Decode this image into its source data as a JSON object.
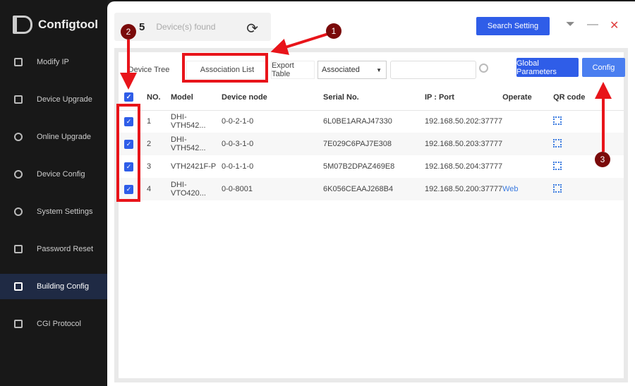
{
  "app": {
    "title": "Configtool"
  },
  "sidebar": {
    "items": [
      {
        "label": "Modify IP",
        "icon": "modify-ip-icon"
      },
      {
        "label": "Device Upgrade",
        "icon": "upgrade-icon"
      },
      {
        "label": "Online Upgrade",
        "icon": "cloud-upgrade-icon"
      },
      {
        "label": "Device Config",
        "icon": "config-icon"
      },
      {
        "label": "System Settings",
        "icon": "settings-icon"
      },
      {
        "label": "Password Reset",
        "icon": "lock-icon"
      },
      {
        "label": "Building Config",
        "icon": "building-icon",
        "active": true
      },
      {
        "label": "CGI Protocol",
        "icon": "cgi-icon"
      }
    ]
  },
  "header": {
    "count": "5",
    "found_label": "Device(s) found",
    "search_setting": "Search Setting"
  },
  "toolbar": {
    "device_tree": "Device Tree",
    "association_list": "Association List",
    "export_table": "Export Table",
    "filter_value": "Associated",
    "search_value": "",
    "global_parameters": "Global Parameters",
    "config": "Config"
  },
  "table": {
    "headers": [
      "NO.",
      "Model",
      "Device node",
      "Serial No.",
      "IP : Port",
      "Operate",
      "QR code"
    ],
    "rows": [
      {
        "no": "1",
        "model": "DHI-VTH542...",
        "node": "0-0-2-1-0",
        "serial": "6L0BE1ARAJ47330",
        "ip": "192.168.50.202:37777",
        "operate": ""
      },
      {
        "no": "2",
        "model": "DHI-VTH542...",
        "node": "0-0-3-1-0",
        "serial": "7E029C6PAJ7E308",
        "ip": "192.168.50.203:37777",
        "operate": ""
      },
      {
        "no": "3",
        "model": "VTH2421F-P",
        "node": "0-0-1-1-0",
        "serial": "5M07B2DPAZ469E8",
        "ip": "192.168.50.204:37777",
        "operate": ""
      },
      {
        "no": "4",
        "model": "DHI-VTO420...",
        "node": "0-0-8001",
        "serial": "6K056CEAAJ268B4",
        "ip": "192.168.50.200:37777",
        "operate": "Web"
      }
    ]
  },
  "annotations": {
    "step1": "1",
    "step2": "2",
    "step3": "3"
  },
  "colors": {
    "accent": "#2f5de8",
    "annotation": "#e8141a"
  }
}
